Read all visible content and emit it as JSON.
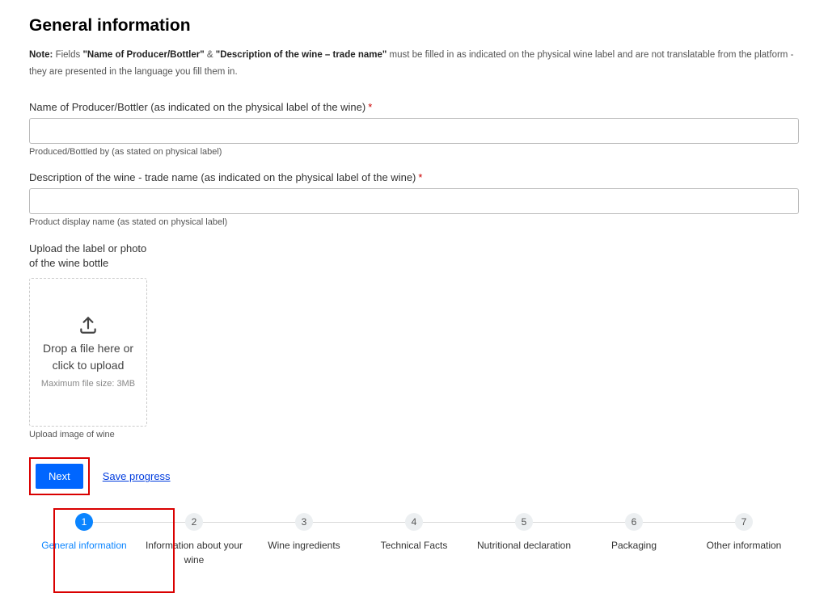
{
  "page": {
    "title": "General information"
  },
  "note": {
    "prefix": "Note:",
    "text1": " Fields ",
    "field1": "\"Name of Producer/Bottler\"",
    "amp": " & ",
    "field2": "\"Description of the wine – trade name\"",
    "text2": " must be filled in as indicated on the physical wine label and are not translatable from the platform - they are presented in the language you fill them in."
  },
  "fields": {
    "producer": {
      "label": "Name of Producer/Bottler (as indicated on the physical label of the wine)",
      "value": "",
      "helper": "Produced/Bottled by (as stated on physical label)"
    },
    "description": {
      "label": "Description of the wine - trade name (as indicated on the physical label of the wine)",
      "value": "",
      "helper": "Product display name (as stated on physical label)"
    },
    "upload": {
      "label_line1": "Upload the label or photo",
      "label_line2": "of the wine bottle",
      "dz_main": "Drop a file here or click to upload",
      "dz_sub": "Maximum file size: 3MB",
      "helper": "Upload image of wine"
    }
  },
  "actions": {
    "next": "Next",
    "save": "Save progress"
  },
  "steps": [
    {
      "num": "1",
      "label": "General information",
      "active": true
    },
    {
      "num": "2",
      "label": "Information about your wine",
      "active": false
    },
    {
      "num": "3",
      "label": "Wine ingredients",
      "active": false
    },
    {
      "num": "4",
      "label": "Technical Facts",
      "active": false
    },
    {
      "num": "5",
      "label": "Nutritional declaration",
      "active": false
    },
    {
      "num": "6",
      "label": "Packaging",
      "active": false
    },
    {
      "num": "7",
      "label": "Other information",
      "active": false
    }
  ]
}
